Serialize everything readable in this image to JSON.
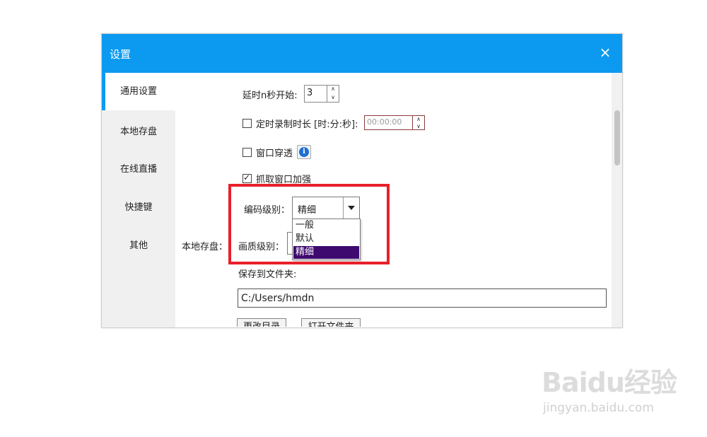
{
  "window": {
    "title": "设置",
    "close_label": "×"
  },
  "sidebar": {
    "items": [
      {
        "label": "通用设置",
        "active": true
      },
      {
        "label": "本地存盘",
        "active": false
      },
      {
        "label": "在线直播",
        "active": false
      },
      {
        "label": "快捷键",
        "active": false
      },
      {
        "label": "其他",
        "active": false
      }
    ]
  },
  "settings": {
    "delay_label": "延时n秒开始:",
    "delay_value": "3",
    "timer_label": "定时录制时长 [时:分:秒]:",
    "timer_value": "00:00:00",
    "timer_checked": false,
    "window_through_label": "窗口穿透",
    "window_through_checked": false,
    "capture_enhance_label": "抓取窗口加强",
    "capture_enhance_checked": true
  },
  "local_save": {
    "section_label": "本地存盘：",
    "encode_level_label": "编码级别：",
    "encode_level_value": "精细",
    "encode_level_options": [
      "一般",
      "默认",
      "精细"
    ],
    "quality_level_label": "画质级别：",
    "save_folder_label": "保存到文件夹:",
    "save_folder_value": "C:/Users/hmdn",
    "change_dir_button": "更改目录",
    "open_folder_button": "打开文件夹"
  },
  "watermark": {
    "logo": "Baidu经验",
    "sub": "jingyan.baidu.com"
  },
  "colors": {
    "accent": "#0c9af0",
    "highlight_border": "#e8202a",
    "selected_option": "#3e0a6f"
  },
  "icons": {
    "info": "info-icon",
    "close": "close-icon",
    "dropdown": "chevron-down-icon"
  }
}
